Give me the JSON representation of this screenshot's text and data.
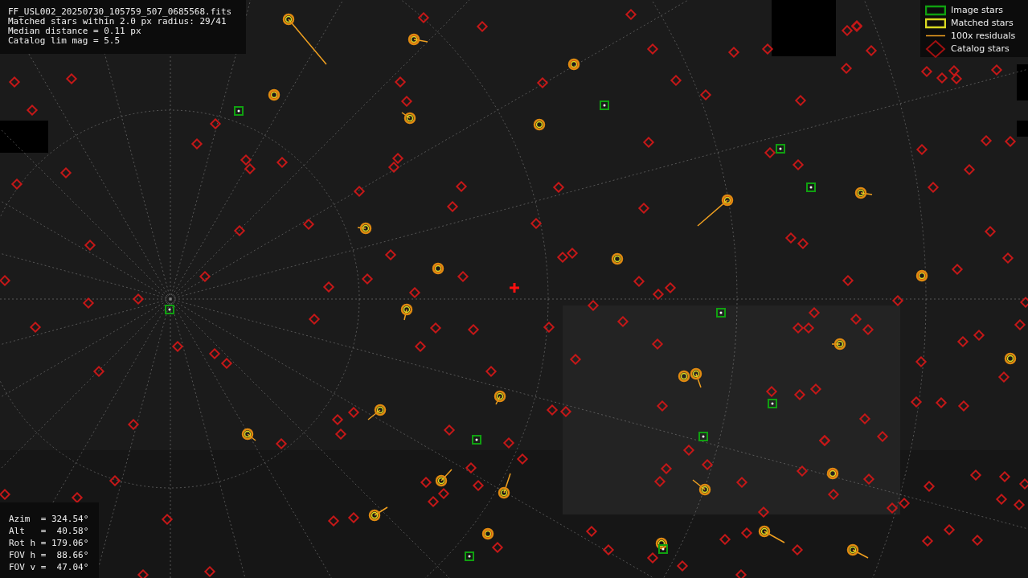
{
  "info_panel": {
    "lines": [
      "FF_USL002_20250730_105759_507_0685568.fits",
      "Matched stars within 2.0 px radius: 29/41",
      "Median distance = 0.11 px",
      "Catalog lim mag = 5.5"
    ]
  },
  "legend": {
    "items": [
      {
        "kind": "image",
        "label": "Image stars"
      },
      {
        "kind": "matched",
        "label": "Matched stars"
      },
      {
        "kind": "residual",
        "label": "100x residuals"
      },
      {
        "kind": "catalog",
        "label": "Catalog stars"
      }
    ]
  },
  "pose_panel": {
    "lines": [
      "Azim  = 324.54°",
      "Alt   =  40.58°",
      "Rot h = 179.06°",
      "FOV h =  88.66°",
      "FOV v =  47.04°"
    ]
  }
}
